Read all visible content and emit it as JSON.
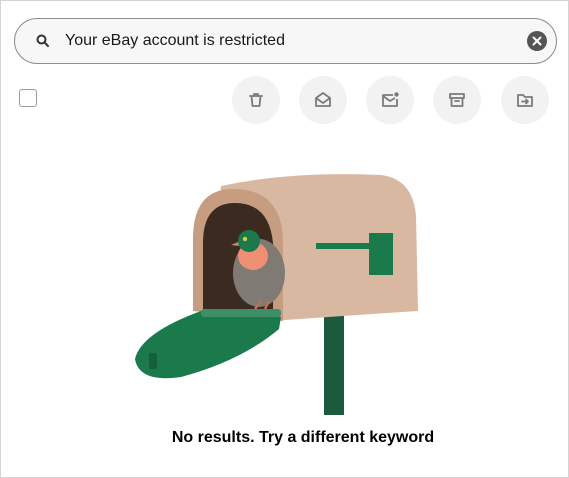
{
  "search": {
    "value": "Your eBay account is restricted",
    "icon": "search-icon",
    "clear_icon": "clear-icon"
  },
  "toolbar": {
    "select_all": false,
    "actions": [
      {
        "name": "delete",
        "icon": "trash-icon"
      },
      {
        "name": "mark-read",
        "icon": "envelope-open-icon"
      },
      {
        "name": "mark-unread",
        "icon": "envelope-dot-icon"
      },
      {
        "name": "archive",
        "icon": "archive-icon"
      },
      {
        "name": "move",
        "icon": "folder-move-icon"
      }
    ]
  },
  "empty_state": {
    "message": "No results. Try a different keyword",
    "illustration": "mailbox-with-pigeon"
  },
  "colors": {
    "accent_green": "#1a7a4c",
    "mailbox_tan": "#d8b8a0",
    "icon_grey": "#6b6b6b",
    "button_bg": "#f2f2f2"
  }
}
